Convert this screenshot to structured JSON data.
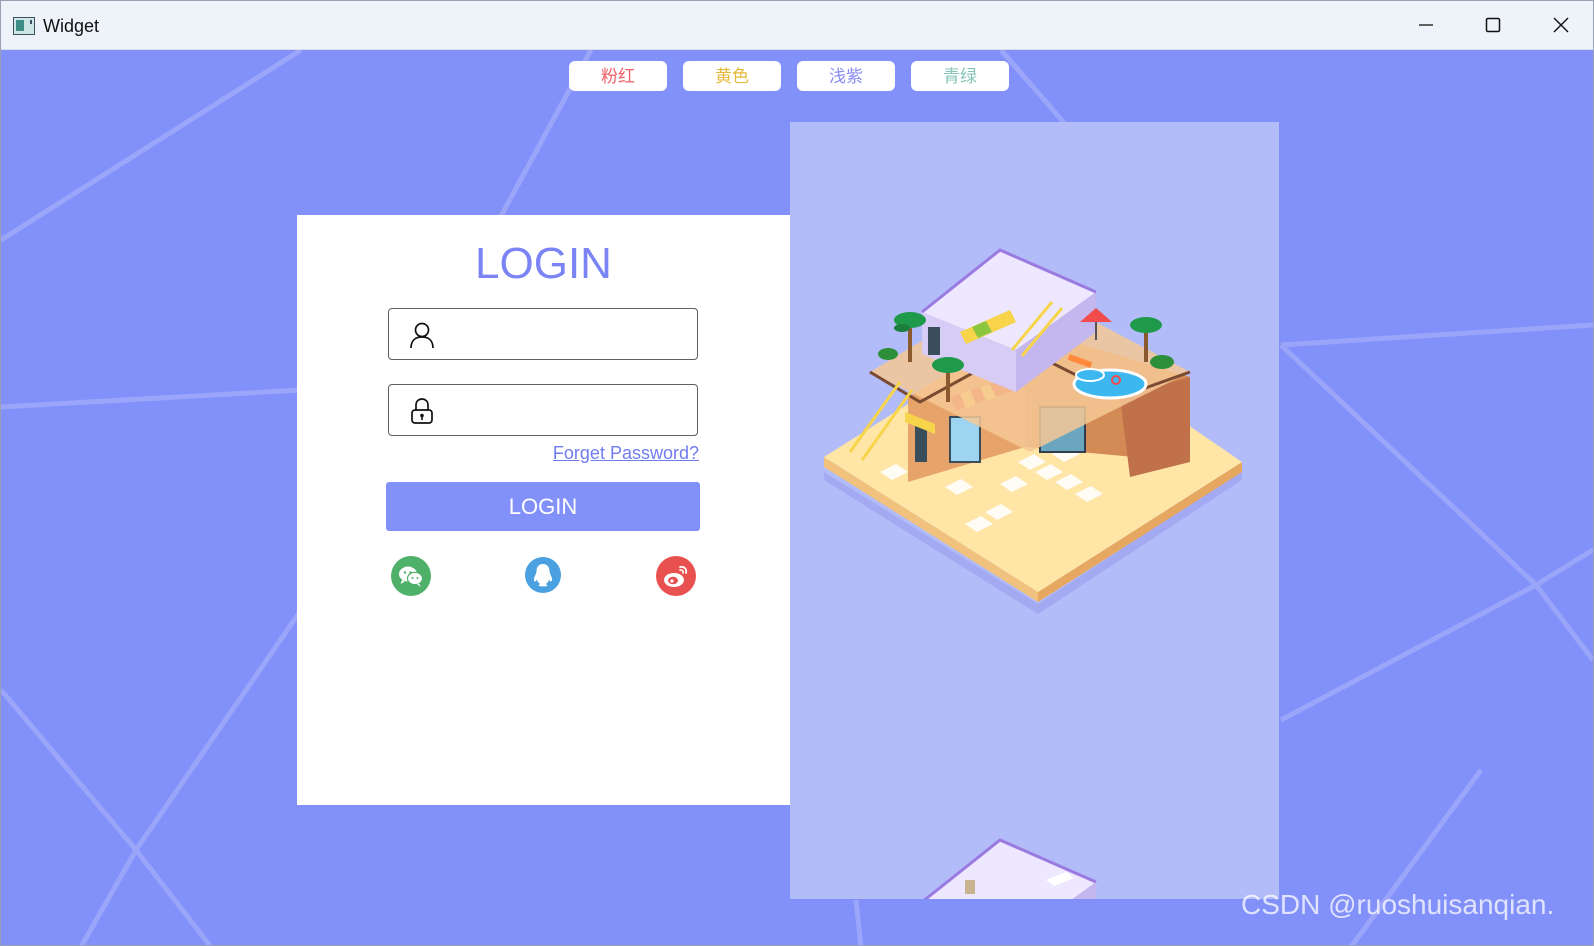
{
  "window": {
    "title": "Widget"
  },
  "color_buttons": [
    {
      "label": "粉红",
      "color": "#f0606a"
    },
    {
      "label": "黄色",
      "color": "#e4b93a"
    },
    {
      "label": "浅紫",
      "color": "#8a8ef4"
    },
    {
      "label": "青绿",
      "color": "#86c3b6"
    }
  ],
  "login": {
    "title": "LOGIN",
    "username": {
      "icon": "user-icon",
      "value": "",
      "placeholder": ""
    },
    "password": {
      "icon": "lock-icon",
      "value": "",
      "placeholder": ""
    },
    "forget_label": "Forget Password?",
    "button_label": "LOGIN",
    "social": [
      "wechat-icon",
      "qq-icon",
      "weibo-icon"
    ]
  },
  "colors": {
    "background": "#8290f9",
    "panel": "#ffffff",
    "image_panel": "#b2bcf9",
    "accent": "#7b84f5"
  },
  "watermark": "CSDN @ruoshuisanqian."
}
